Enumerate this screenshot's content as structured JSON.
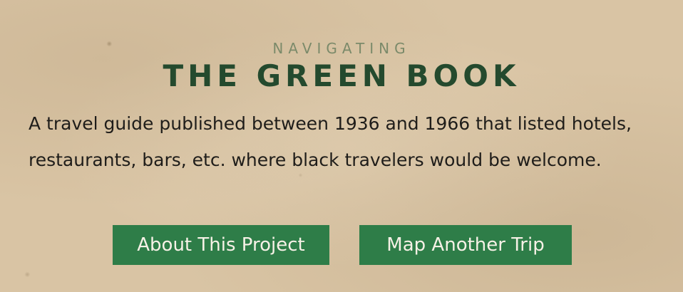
{
  "hero": {
    "eyebrow": "NAVIGATING",
    "title": "THE GREEN BOOK",
    "description": "A travel guide published between 1936 and 1966 that listed hotels, restaurants, bars, etc. where black travelers would be welcome."
  },
  "actions": {
    "about_label": "About This Project",
    "map_label": "Map Another Trip"
  },
  "colors": {
    "background": "#d9c4a4",
    "eyebrow": "#7b8a6a",
    "title": "#244a2e",
    "button": "#2e7d48",
    "button_text": "#f6f1e6",
    "body_text": "#1f1d1a"
  }
}
